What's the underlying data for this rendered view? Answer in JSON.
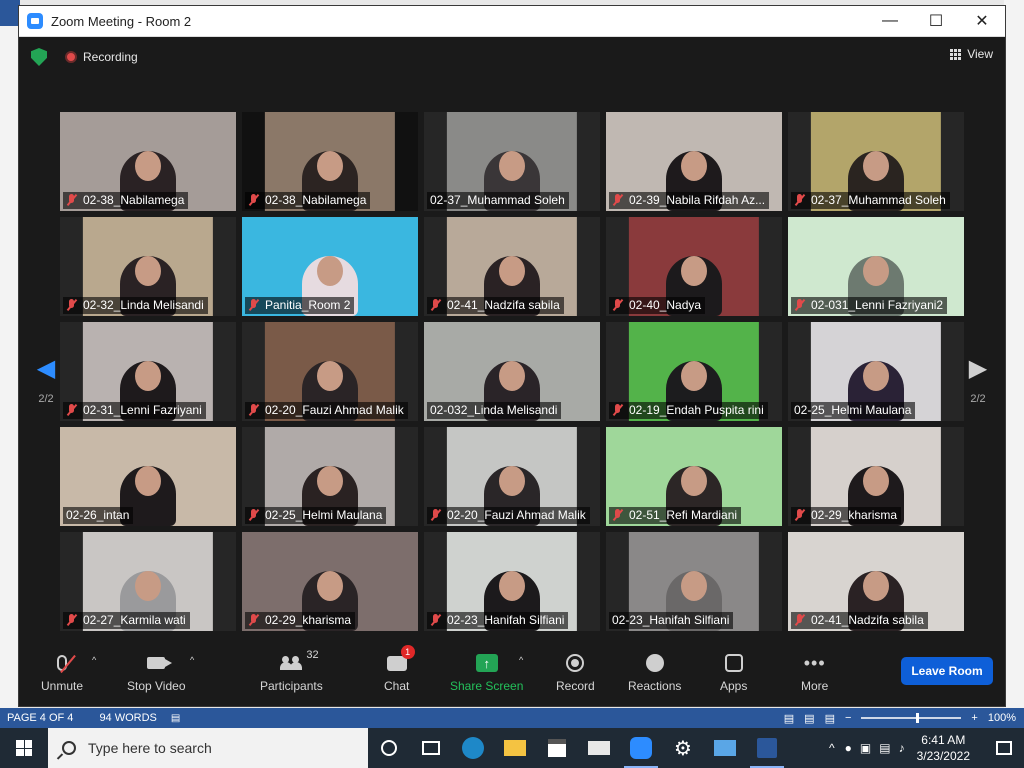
{
  "window": {
    "title": "Zoom Meeting - Room 2"
  },
  "topbar": {
    "recording_label": "Recording",
    "view_label": "View"
  },
  "pager": {
    "left": "2/2",
    "right": "2/2"
  },
  "colors": {
    "accent": "#2d8cff",
    "leave": "#0e5fd8",
    "active_speaker": "#d7e74a",
    "mute_red": "#e04a4a",
    "share_green": "#23a455",
    "word_blue": "#2b579a"
  },
  "tiles": [
    {
      "name": "02-38_Nabilamega",
      "muted": true,
      "bg": "#7a6e6c",
      "scene": "#a59c98",
      "fg": "#2a2224"
    },
    {
      "name": "02-38_Nabilamega",
      "muted": true,
      "bg": "#111111",
      "scene": "#8b7868",
      "fg": "#2c2422"
    },
    {
      "name": "02-37_Muhammad Soleh",
      "muted": false,
      "bg": "#262626",
      "scene": "#8a8a88",
      "fg": "#3a3638"
    },
    {
      "name": "02-39_Nabila Rifdah Az...",
      "muted": true,
      "bg": "#262626",
      "scene": "#c0b8b2",
      "fg": "#1e1a1c"
    },
    {
      "name": "02-37_Muhammad Soleh",
      "muted": true,
      "bg": "#262626",
      "scene": "#b3a56a",
      "fg": "#2a2420"
    },
    {
      "name": "02-32_Linda Melisandi",
      "muted": true,
      "bg": "#262626",
      "scene": "#b9a88e",
      "fg": "#2a2224"
    },
    {
      "name": "Panitia_Room 2",
      "muted": true,
      "bg": "#262626",
      "scene": "#3ab7e0",
      "fg": "#e6dbe0",
      "active": true
    },
    {
      "name": "02-41_Nadzifa sabila",
      "muted": true,
      "bg": "#262626",
      "scene": "#b8a999",
      "fg": "#2a2224"
    },
    {
      "name": "02-40_Nadya",
      "muted": true,
      "bg": "#262626",
      "scene": "#8a3a3c",
      "fg": "#1c1a1c"
    },
    {
      "name": "02-031_Lenni Fazriyani2",
      "muted": true,
      "bg": "#262626",
      "scene": "#cfe8cf",
      "fg": "#6d7a70"
    },
    {
      "name": "02-31_Lenni Fazriyani",
      "muted": true,
      "bg": "#262626",
      "scene": "#b9b2b0",
      "fg": "#1e1a1c"
    },
    {
      "name": "02-20_Fauzi Ahmad Malik",
      "muted": true,
      "bg": "#262626",
      "scene": "#7a5a48",
      "fg": "#2a2426"
    },
    {
      "name": "02-032_Linda Melisandi",
      "muted": false,
      "bg": "#262626",
      "scene": "#a8aaa6",
      "fg": "#2a2428"
    },
    {
      "name": "02-19_Endah Puspita rini",
      "muted": true,
      "bg": "#262626",
      "scene": "#53b34a",
      "fg": "#1c1c1e"
    },
    {
      "name": "02-25_Helmi Maulana",
      "muted": false,
      "bg": "#262626",
      "scene": "#d5d3d6",
      "fg": "#2a2236"
    },
    {
      "name": "02-26_intan",
      "muted": false,
      "bg": "#262626",
      "scene": "#c8b9a8",
      "fg": "#1e1a1c"
    },
    {
      "name": "02-25_Helmi Maulana",
      "muted": true,
      "bg": "#262626",
      "scene": "#b0aaa8",
      "fg": "#2a2222"
    },
    {
      "name": "02-20_Fauzi Ahmad Malik",
      "muted": true,
      "bg": "#262626",
      "scene": "#c5c6c4",
      "fg": "#2a2628"
    },
    {
      "name": "02-51_Refi Mardiani",
      "muted": true,
      "bg": "#262626",
      "scene": "#9fd79a",
      "fg": "#2c2626"
    },
    {
      "name": "02-29_kharisma",
      "muted": true,
      "bg": "#262626",
      "scene": "#d6d0cc",
      "fg": "#1e1a1c"
    },
    {
      "name": "02-27_Karmila wati",
      "muted": true,
      "bg": "#262626",
      "scene": "#c9c6c4",
      "fg": "#9a9a9c"
    },
    {
      "name": "02-29_kharisma",
      "muted": true,
      "bg": "#262626",
      "scene": "#7d6e6c",
      "fg": "#2a2426"
    },
    {
      "name": "02-23_Hanifah Silfiani",
      "muted": true,
      "bg": "#262626",
      "scene": "#cfd2cf",
      "fg": "#1c1a1c"
    },
    {
      "name": "02-23_Hanifah Silfiani",
      "muted": false,
      "bg": "#262626",
      "scene": "#8a8888",
      "fg": "#6a6868"
    },
    {
      "name": "02-41_Nadzifa sabila",
      "muted": true,
      "bg": "#262626",
      "scene": "#d8d4d0",
      "fg": "#2a2224"
    }
  ],
  "toolbar": {
    "unmute": "Unmute",
    "stop_video": "Stop Video",
    "participants": "Participants",
    "participants_count": "32",
    "chat": "Chat",
    "chat_badge": "1",
    "share": "Share Screen",
    "record": "Record",
    "reactions": "Reactions",
    "apps": "Apps",
    "more": "More",
    "leave": "Leave Room"
  },
  "word_status": {
    "page": "PAGE 4 OF 4",
    "words": "94 WORDS",
    "zoom": "100%"
  },
  "taskbar": {
    "search_placeholder": "Type here to search",
    "time": "6:41 AM",
    "date": "3/23/2022"
  }
}
